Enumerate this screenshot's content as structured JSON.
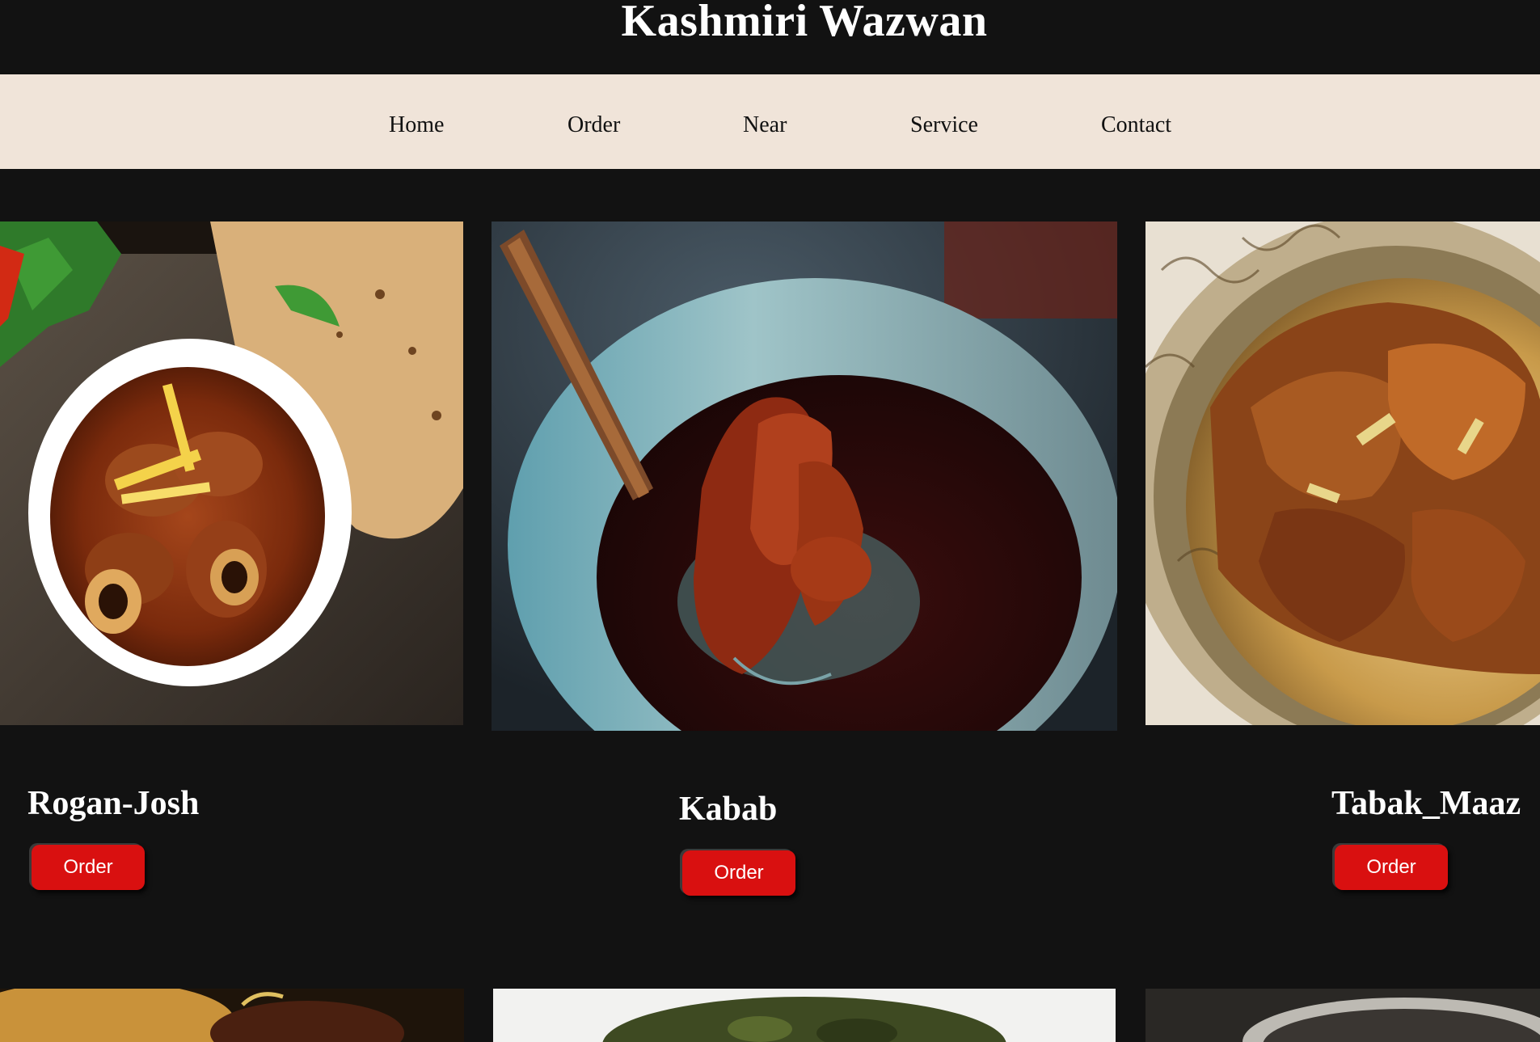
{
  "header": {
    "title": "Kashmiri Wazwan"
  },
  "nav": {
    "items": [
      {
        "label": "Home"
      },
      {
        "label": "Order"
      },
      {
        "label": "Near"
      },
      {
        "label": "Service"
      },
      {
        "label": "Contact"
      }
    ]
  },
  "dishes": [
    {
      "name": "Rogan-Josh",
      "button": "Order",
      "photo": "rogan-josh-photo"
    },
    {
      "name": "Kabab",
      "button": "Order",
      "photo": "kabab-photo"
    },
    {
      "name": "Tabak_Maaz",
      "button": "Order",
      "photo": "tabak-maaz-photo"
    }
  ],
  "next_row_photos": [
    "dish-photo-4",
    "dish-photo-5",
    "dish-photo-6"
  ],
  "colors": {
    "page_background": "#121212",
    "nav_background": "#f0e4d9",
    "button": "#d91010",
    "title_text": "#ffffff"
  }
}
